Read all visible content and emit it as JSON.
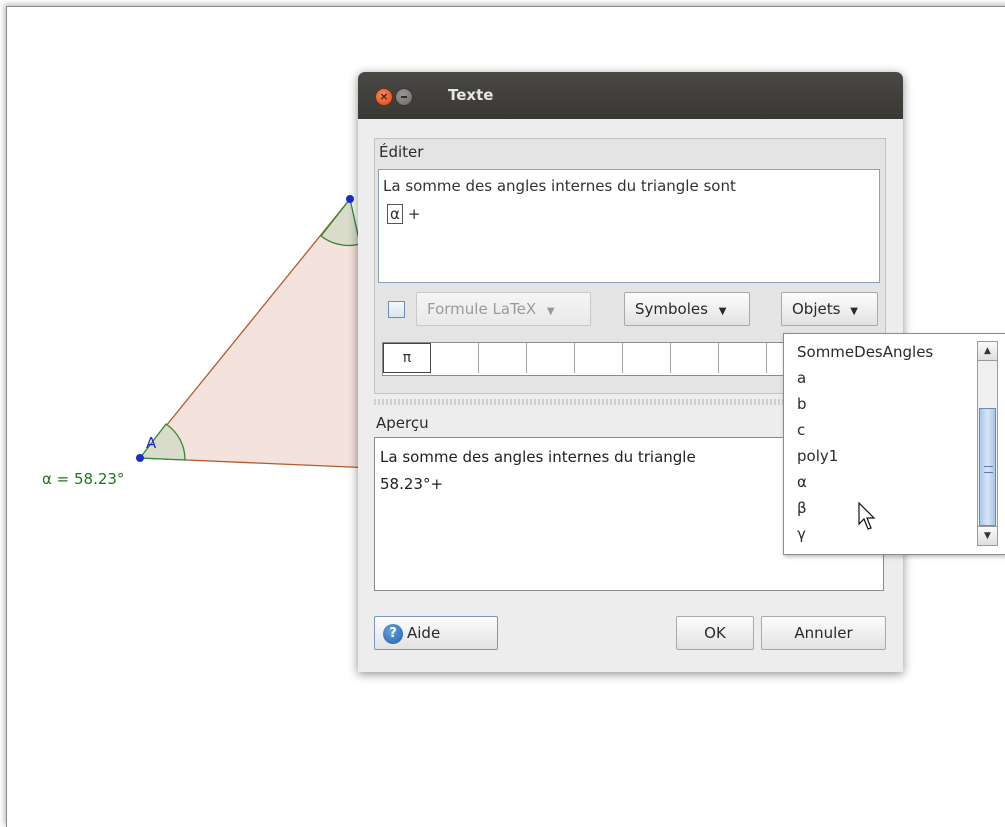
{
  "canvas": {
    "angle_label": "α = 58.23°",
    "point_label": "A"
  },
  "dialog": {
    "title": "Texte",
    "edit_section_label": "Éditer",
    "edit_text_line1": "La somme des angles internes du triangle sont",
    "edit_token": "α",
    "edit_text_line2_suffix": "+",
    "latex_label": "Formule LaTeX",
    "symbols_button": "Symboles",
    "objects_button": "Objets",
    "symbol_first": "π",
    "preview_label": "Aperçu",
    "preview_line1": "La somme des angles internes du triangle",
    "preview_line2": "58.23°+",
    "help_button": "Aide",
    "ok_button": "OK",
    "cancel_button": "Annuler"
  },
  "objects_menu": {
    "items": [
      "SommeDesAngles",
      "a",
      "b",
      "c",
      "poly1",
      "α",
      "β",
      "γ"
    ]
  },
  "colors": {
    "angle_green": "#1a7a1a",
    "polygon_fill": "#f4e2dc",
    "polygon_stroke": "#b35a2e",
    "point_blue": "#1c2ccc"
  }
}
